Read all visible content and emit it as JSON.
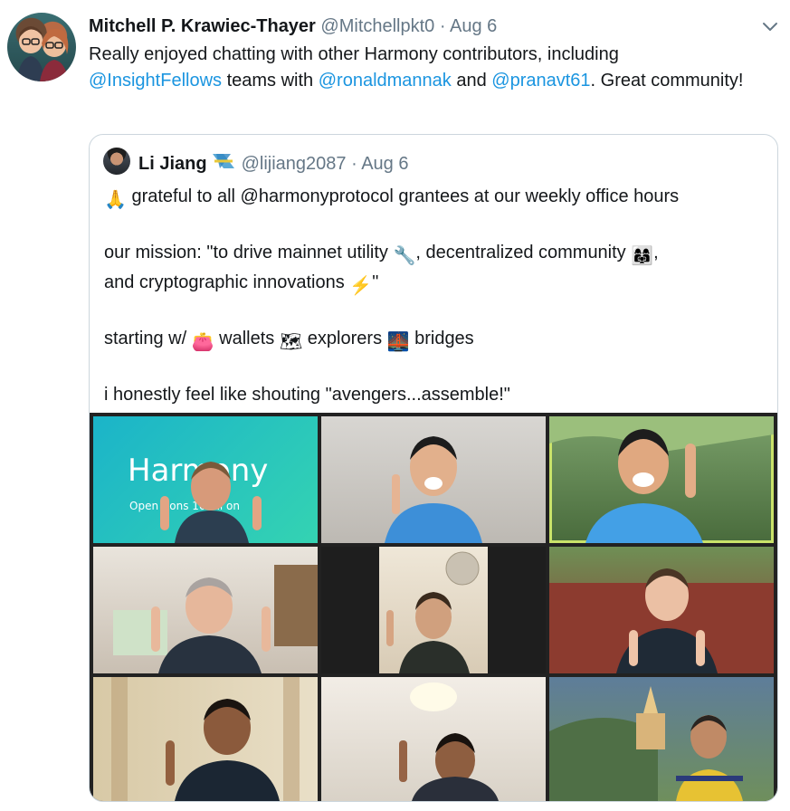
{
  "tweet": {
    "author_name": "Mitchell P. Krawiec-Thayer",
    "handle": "@Mitchellpkt0",
    "date": "Aug 6",
    "text_1": "Really enjoyed chatting with other Harmony contributors, including ",
    "mention_1": "@InsightFellows",
    "text_2": " teams with ",
    "mention_2": "@ronaldmannak",
    "text_3": " and ",
    "mention_3": "@pranavt61",
    "text_4": ". Great community!"
  },
  "quoted": {
    "author_name": "Li Jiang",
    "handle": "@lijiang2087",
    "date": "Aug 6",
    "line1": "grateful to all @harmonyprotocol grantees at our weekly office hours",
    "line2a": "our mission: \"to drive mainnet utility ",
    "line2b": ", decentralized community ",
    "line2c": ",",
    "line3a": "and cryptographic innovations ",
    "line3b": "\"",
    "line4a": "starting w/ ",
    "line4b": " wallets ",
    "line4c": " explorers ",
    "line4d": " bridges",
    "line5": "i honestly feel like shouting \"avengers...assemble!\"",
    "emoji": {
      "pray": "🙏",
      "wrench": "🔧",
      "people": "👩‍👩‍👧",
      "lightning": "⚡",
      "purse": "👛",
      "map": "🗺",
      "bridge": "🌉"
    }
  },
  "image": {
    "logo_text": "Harmony",
    "subtitle": "Open Cons        10 Bil   on"
  },
  "icons": {
    "chevron": "chevron-down-icon",
    "badge": "harmony-badge-icon"
  },
  "colors": {
    "link": "#1b95e0",
    "meta": "#657786",
    "border": "#ccd6dd",
    "active_speaker": "#c9e26a"
  }
}
